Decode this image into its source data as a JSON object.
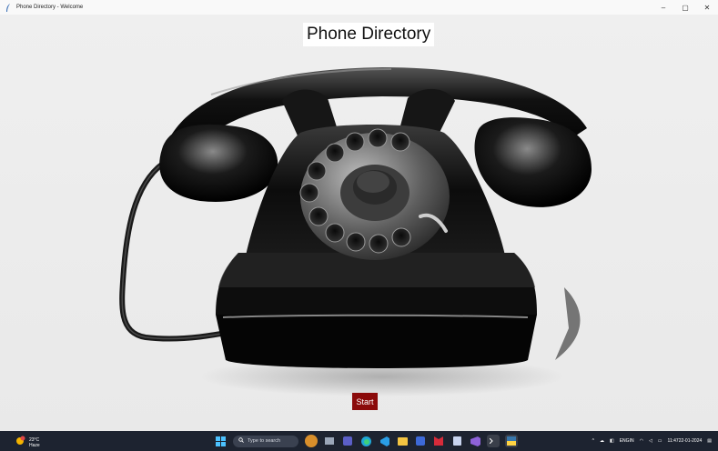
{
  "window": {
    "title": "Phone Directory - Welcome",
    "controls": {
      "minimize": "–",
      "maximize": "▢",
      "close": "✕"
    }
  },
  "app": {
    "heading": "Phone Directory",
    "start_label": "Start",
    "start_color": "#8b0a0a"
  },
  "taskbar": {
    "weather_temp": "23°C",
    "weather_desc": "Haze",
    "search_placeholder": "Type to search",
    "apps": [
      "start-icon",
      "search-icon",
      "widget-icon",
      "chat-icon",
      "edge-icon",
      "vscode-icon",
      "file-explorer-icon",
      "office-icon",
      "mcafee-icon",
      "mail-icon",
      "visual-studio-icon",
      "terminal-icon",
      "python-icon"
    ],
    "lang_top": "ENG",
    "lang_bottom": "IN",
    "time": "11:47",
    "date": "22-01-2024"
  }
}
